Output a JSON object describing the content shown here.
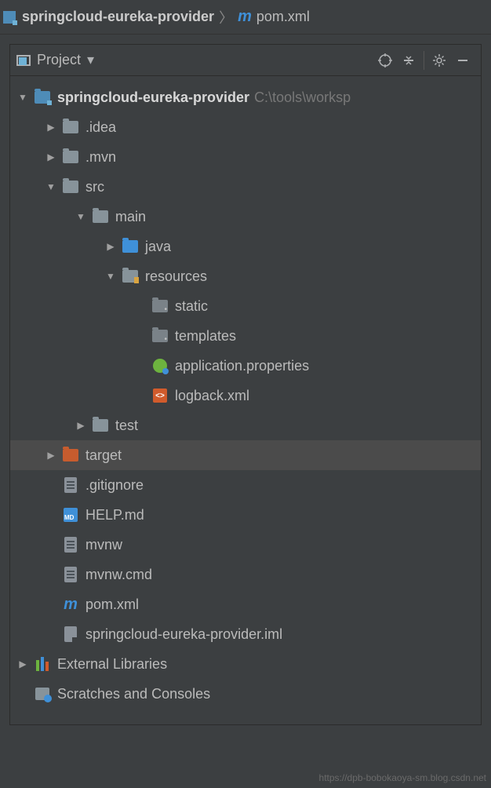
{
  "breadcrumb": {
    "root": "springcloud-eureka-provider",
    "file": "pom.xml"
  },
  "panel": {
    "title": "Project"
  },
  "tree": {
    "root": {
      "name": "springcloud-eureka-provider",
      "path": "C:\\tools\\worksp"
    },
    "idea": ".idea",
    "mvn": ".mvn",
    "src": "src",
    "main": "main",
    "java": "java",
    "resources": "resources",
    "static": "static",
    "templates": "templates",
    "appprops": "application.properties",
    "logback": "logback.xml",
    "test": "test",
    "target": "target",
    "gitignore": ".gitignore",
    "help": "HELP.md",
    "mvnw": "mvnw",
    "mvnwcmd": "mvnw.cmd",
    "pom": "pom.xml",
    "iml": "springcloud-eureka-provider.iml",
    "extlibs": "External Libraries",
    "scratches": "Scratches and Consoles"
  },
  "watermark": "https://dpb-bobokaoya-sm.blog.csdn.net"
}
